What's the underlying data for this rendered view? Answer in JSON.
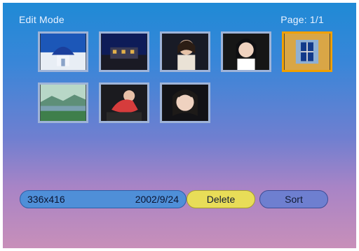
{
  "header": {
    "title": "Edit Mode",
    "page": "Page: 1/1"
  },
  "thumbnails": [
    {
      "icon": "photo-blue-dome-icon"
    },
    {
      "icon": "photo-night-house-icon"
    },
    {
      "icon": "photo-woman-1-icon"
    },
    {
      "icon": "photo-woman-2-icon"
    },
    {
      "icon": "photo-window-icon",
      "selected": true
    },
    {
      "icon": "photo-landscape-icon"
    },
    {
      "icon": "photo-woman-3-icon"
    },
    {
      "icon": "photo-woman-4-icon"
    }
  ],
  "status": {
    "resolution": "336x416",
    "date": "2002/9/24"
  },
  "buttons": {
    "delete_label": "Delete",
    "sort_label": "Sort"
  }
}
